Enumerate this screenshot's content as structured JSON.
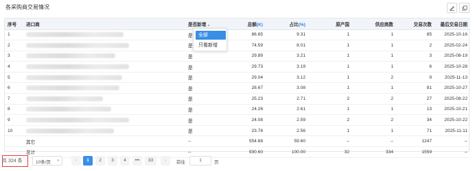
{
  "header": {
    "title": "各采购商交易情况"
  },
  "toolbar": {
    "edit_icon": "edit-icon",
    "copy_icon": "copy-icon"
  },
  "table": {
    "columns": [
      {
        "label": "序号"
      },
      {
        "label": "进口商"
      },
      {
        "label": "是否新增"
      },
      {
        "label": "总额",
        "unit": "(K)"
      },
      {
        "label": "占比",
        "unit": "(%)"
      },
      {
        "label": "原产国"
      },
      {
        "label": "供应商数"
      },
      {
        "label": "交易次数"
      },
      {
        "label": "最后交易日期"
      }
    ],
    "rows": [
      {
        "no": "1",
        "new": "是",
        "total": "86.65",
        "pct": "9.31",
        "origin": "1",
        "suppliers": "1",
        "trades": "85",
        "date": "2025-10-16"
      },
      {
        "no": "2",
        "new": "是",
        "total": "74.59",
        "pct": "8.01",
        "origin": "1",
        "suppliers": "1",
        "trades": "2",
        "date": "2025-02-24"
      },
      {
        "no": "3",
        "new": "是",
        "total": "29.89",
        "pct": "3.21",
        "origin": "1",
        "suppliers": "1",
        "trades": "3",
        "date": "2025-08-19"
      },
      {
        "no": "4",
        "new": "是",
        "total": "29.73",
        "pct": "3.19",
        "origin": "1",
        "suppliers": "1",
        "trades": "6",
        "date": "2025-10-28"
      },
      {
        "no": "5",
        "new": "是",
        "total": "29.04",
        "pct": "3.12",
        "origin": "1",
        "suppliers": "2",
        "trades": "9",
        "date": "2025-11-13"
      },
      {
        "no": "6",
        "new": "是",
        "total": "28.67",
        "pct": "3.08",
        "origin": "1",
        "suppliers": "1",
        "trades": "81",
        "date": "2025-10-27"
      },
      {
        "no": "7",
        "new": "是",
        "total": "25.23",
        "pct": "2.71",
        "origin": "2",
        "suppliers": "2",
        "trades": "27",
        "date": "2025-08-22"
      },
      {
        "no": "8",
        "new": "是",
        "total": "24.26",
        "pct": "2.61",
        "origin": "1",
        "suppliers": "1",
        "trades": "13",
        "date": "2025-10-21"
      },
      {
        "no": "9",
        "new": "是",
        "total": "24.08",
        "pct": "2.59",
        "origin": "2",
        "suppliers": "2",
        "trades": "34",
        "date": "2025-10-22"
      },
      {
        "no": "10",
        "new": "是",
        "total": "23.78",
        "pct": "2.56",
        "origin": "1",
        "suppliers": "1",
        "trades": "71",
        "date": "2025-11-11"
      }
    ],
    "other": {
      "label": "其它",
      "new": "--",
      "total": "554.68",
      "pct": "59.60",
      "origin": "--",
      "suppliers": "--",
      "trades": "1247",
      "date": "--"
    },
    "sum": {
      "label": "总计",
      "new": "--",
      "total": "930.60",
      "pct": "100.00",
      "origin": "32",
      "suppliers": "334",
      "trades": "1559",
      "date": "--"
    }
  },
  "filter_popup": {
    "options": [
      "全部",
      "只看新增"
    ],
    "selected": "全部"
  },
  "pagination": {
    "total_text": "共 324 条",
    "page_size": "10条/页",
    "pages": [
      "1",
      "2",
      "3",
      "4",
      "•••",
      "33"
    ],
    "current": "1",
    "prev": "‹",
    "next": "›",
    "goto_label": "前往",
    "goto_value": "1",
    "goto_unit": "页"
  },
  "colors": {
    "accent": "#3a8ee6",
    "highlight_border": "#e53935",
    "header_bg": "#f1f4f8"
  }
}
